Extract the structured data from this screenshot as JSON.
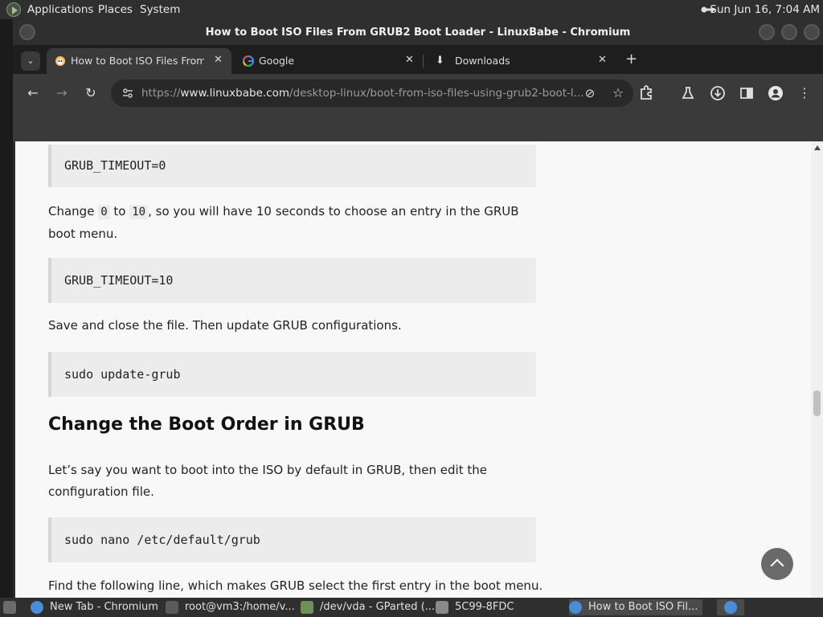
{
  "top_panel": {
    "menus": [
      "Applications",
      "Places",
      "System"
    ],
    "clock": "Sun Jun 16,  7:04 AM"
  },
  "window": {
    "title": "How to Boot ISO Files From GRUB2 Boot Loader - LinuxBabe - Chromium"
  },
  "tabs": [
    {
      "label": "How to Boot ISO Files From GRUB2",
      "icon": "linuxbabe-favicon",
      "active": true
    },
    {
      "label": "Google",
      "icon": "google-favicon",
      "active": false
    },
    {
      "label": "Downloads",
      "icon": "download-icon",
      "active": false
    }
  ],
  "address_bar": {
    "scheme": "https://",
    "host": "www.linuxbabe.com",
    "path": "/desktop-linux/boot-from-iso-files-using-grub2-boot-l..."
  },
  "article": {
    "code1": "GRUB_TIMEOUT=0",
    "para1_before": "Change ",
    "para1_code1": "0",
    "para1_mid": " to ",
    "para1_code2": "10",
    "para1_after": ", so you will have 10 seconds to choose an entry in the GRUB boot menu.",
    "code2": "GRUB_TIMEOUT=10",
    "para2": "Save and close the file. Then update GRUB configurations.",
    "code3": "sudo update-grub",
    "heading": "Change the Boot Order in GRUB",
    "para3": "Let’s say you want to boot into the ISO by default in GRUB, then edit the configuration file.",
    "code4": "sudo nano /etc/default/grub",
    "para4": "Find the following line, which makes GRUB select the first entry in the boot menu."
  },
  "taskbar": {
    "items": [
      {
        "label": "New Tab - Chromium",
        "active": false
      },
      {
        "label": "root@vm3:/home/v...",
        "active": false
      },
      {
        "label": "/dev/vda - GParted (...",
        "active": false
      },
      {
        "label": "5C99-8FDC",
        "active": false
      },
      {
        "label": "How to Boot ISO Fil...",
        "active": true
      }
    ]
  },
  "colors": {
    "page_bg": "#f8f8f8",
    "code_bg": "#ececec",
    "chrome_dark": "#3a3a3a"
  }
}
